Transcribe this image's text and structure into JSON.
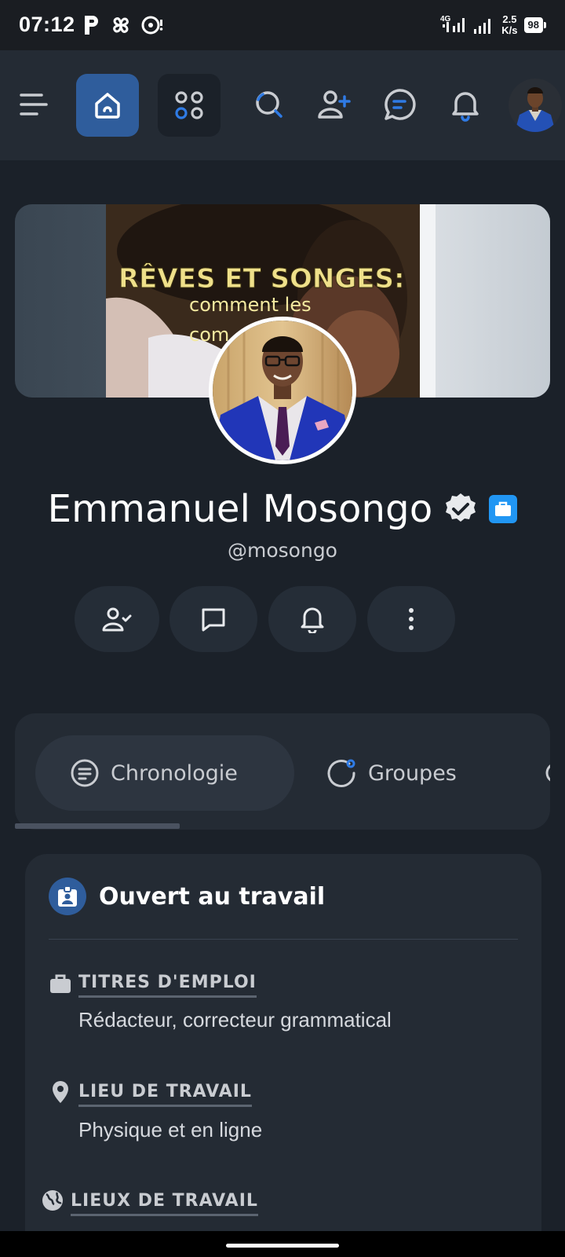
{
  "status_bar": {
    "time": "07:12",
    "network_type": "4G",
    "net_speed_value": "2.5",
    "net_speed_unit": "K/s",
    "battery": "98"
  },
  "header": {
    "icons": [
      "menu-icon",
      "home-icon",
      "apps-icon",
      "search-icon",
      "add-user-icon",
      "messages-icon",
      "notifications-icon",
      "avatar"
    ]
  },
  "cover": {
    "title": "RÊVES ET SONGES:",
    "subtitle_line1": "comment les",
    "subtitle_line2": "com"
  },
  "profile": {
    "name": "Emmanuel Mosongo",
    "handle": "@mosongo",
    "verified": true,
    "open_to_work_badge": true
  },
  "tabs": [
    {
      "label": "Chronologie",
      "icon": "timeline-icon",
      "active": true
    },
    {
      "label": "Groupes",
      "icon": "groups-icon",
      "active": false
    }
  ],
  "open_to_work": {
    "title": "Ouvert au travail",
    "fields": [
      {
        "label": "TITRES D'EMPLOI",
        "value": "Rédacteur, correcteur grammatical",
        "icon": "briefcase-icon"
      },
      {
        "label": "LIEU DE TRAVAIL",
        "value": "Physique et en ligne",
        "icon": "location-pin-icon"
      },
      {
        "label": "LIEUX DE TRAVAIL",
        "value": "",
        "icon": "globe-icon"
      }
    ]
  },
  "colors": {
    "background": "#1b2129",
    "surface": "#242b34",
    "accent": "#2f5d9c",
    "verified_badge": "#2196f3"
  }
}
